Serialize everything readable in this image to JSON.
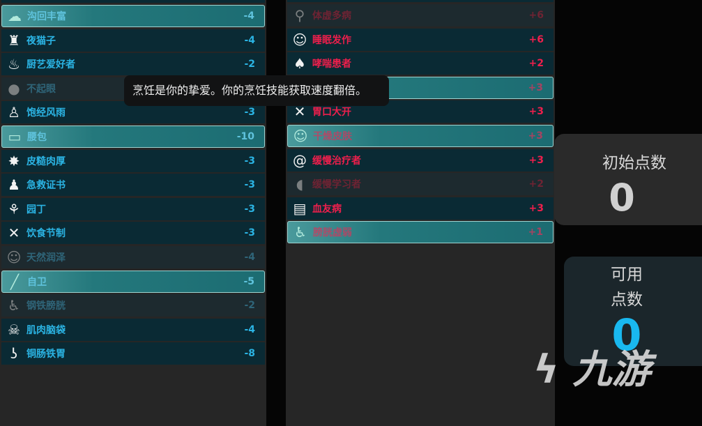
{
  "positive_traits": [
    {
      "name": "沟回丰富",
      "value": "-4",
      "icon": "brain-icon",
      "state": "selected"
    },
    {
      "name": "夜猫子",
      "value": "-4",
      "icon": "owl-icon",
      "state": "normal"
    },
    {
      "name": "厨艺爱好者",
      "value": "-2",
      "icon": "cooking-icon",
      "state": "normal"
    },
    {
      "name": "不起眼",
      "value": "",
      "icon": "hooded-face-icon",
      "state": "dim"
    },
    {
      "name": "饱经风雨",
      "value": "-3",
      "icon": "person-icon",
      "state": "normal"
    },
    {
      "name": "腰包",
      "value": "-10",
      "icon": "fanny-pack-icon",
      "state": "selected"
    },
    {
      "name": "皮糙肉厚",
      "value": "-3",
      "icon": "hide-icon",
      "state": "normal"
    },
    {
      "name": "急救证书",
      "value": "-3",
      "icon": "medic-icon",
      "state": "normal"
    },
    {
      "name": "园丁",
      "value": "-3",
      "icon": "plant-icon",
      "state": "normal"
    },
    {
      "name": "饮食节制",
      "value": "-3",
      "icon": "fork-knife-icon",
      "state": "normal"
    },
    {
      "name": "天然润泽",
      "value": "-4",
      "icon": "face-icon",
      "state": "dim"
    },
    {
      "name": "自卫",
      "value": "-5",
      "icon": "bat-icon",
      "state": "selected"
    },
    {
      "name": "钢铁膀胱",
      "value": "-2",
      "icon": "toilet-icon",
      "state": "dim"
    },
    {
      "name": "肌肉脑袋",
      "value": "-4",
      "icon": "skull-icon",
      "state": "normal"
    },
    {
      "name": "铜肠铁胃",
      "value": "-8",
      "icon": "stomach-icon",
      "state": "normal"
    }
  ],
  "negative_traits": [
    {
      "name": "体虚多病",
      "value": "+6",
      "icon": "elderly-icon",
      "state": "dim"
    },
    {
      "name": "睡眠发作",
      "value": "+6",
      "icon": "sleepy-face-icon",
      "state": "normal"
    },
    {
      "name": "哮喘患者",
      "value": "+2",
      "icon": "lungs-icon",
      "state": "normal"
    },
    {
      "name": "",
      "value": "+3",
      "icon": "hidden-icon",
      "state": "selected"
    },
    {
      "name": "胃口大开",
      "value": "+3",
      "icon": "fork-knife-icon",
      "state": "normal"
    },
    {
      "name": "干燥皮肤",
      "value": "+3",
      "icon": "face-icon",
      "state": "selected"
    },
    {
      "name": "缓慢治疗者",
      "value": "+3",
      "icon": "snail-icon",
      "state": "normal"
    },
    {
      "name": "缓慢学习者",
      "value": "+2",
      "icon": "head-icon",
      "state": "dim"
    },
    {
      "name": "血友病",
      "value": "+3",
      "icon": "bandage-icon",
      "state": "normal"
    },
    {
      "name": "膀胱虚弱",
      "value": "+1",
      "icon": "toilet-icon",
      "state": "selected"
    }
  ],
  "tooltip": "烹饪是你的挚爱。你的烹饪技能获取速度翻倍。",
  "initial_points": {
    "label": "初始点数",
    "value": "0"
  },
  "available_points": {
    "label1": "可用",
    "label2": "点数",
    "value": "0"
  },
  "watermark": "九游",
  "colors": {
    "positive_text": "#2bb4e4",
    "negative_text": "#ee1f4c",
    "available_value": "#19b8ef",
    "initial_value": "#d0d0d0"
  }
}
